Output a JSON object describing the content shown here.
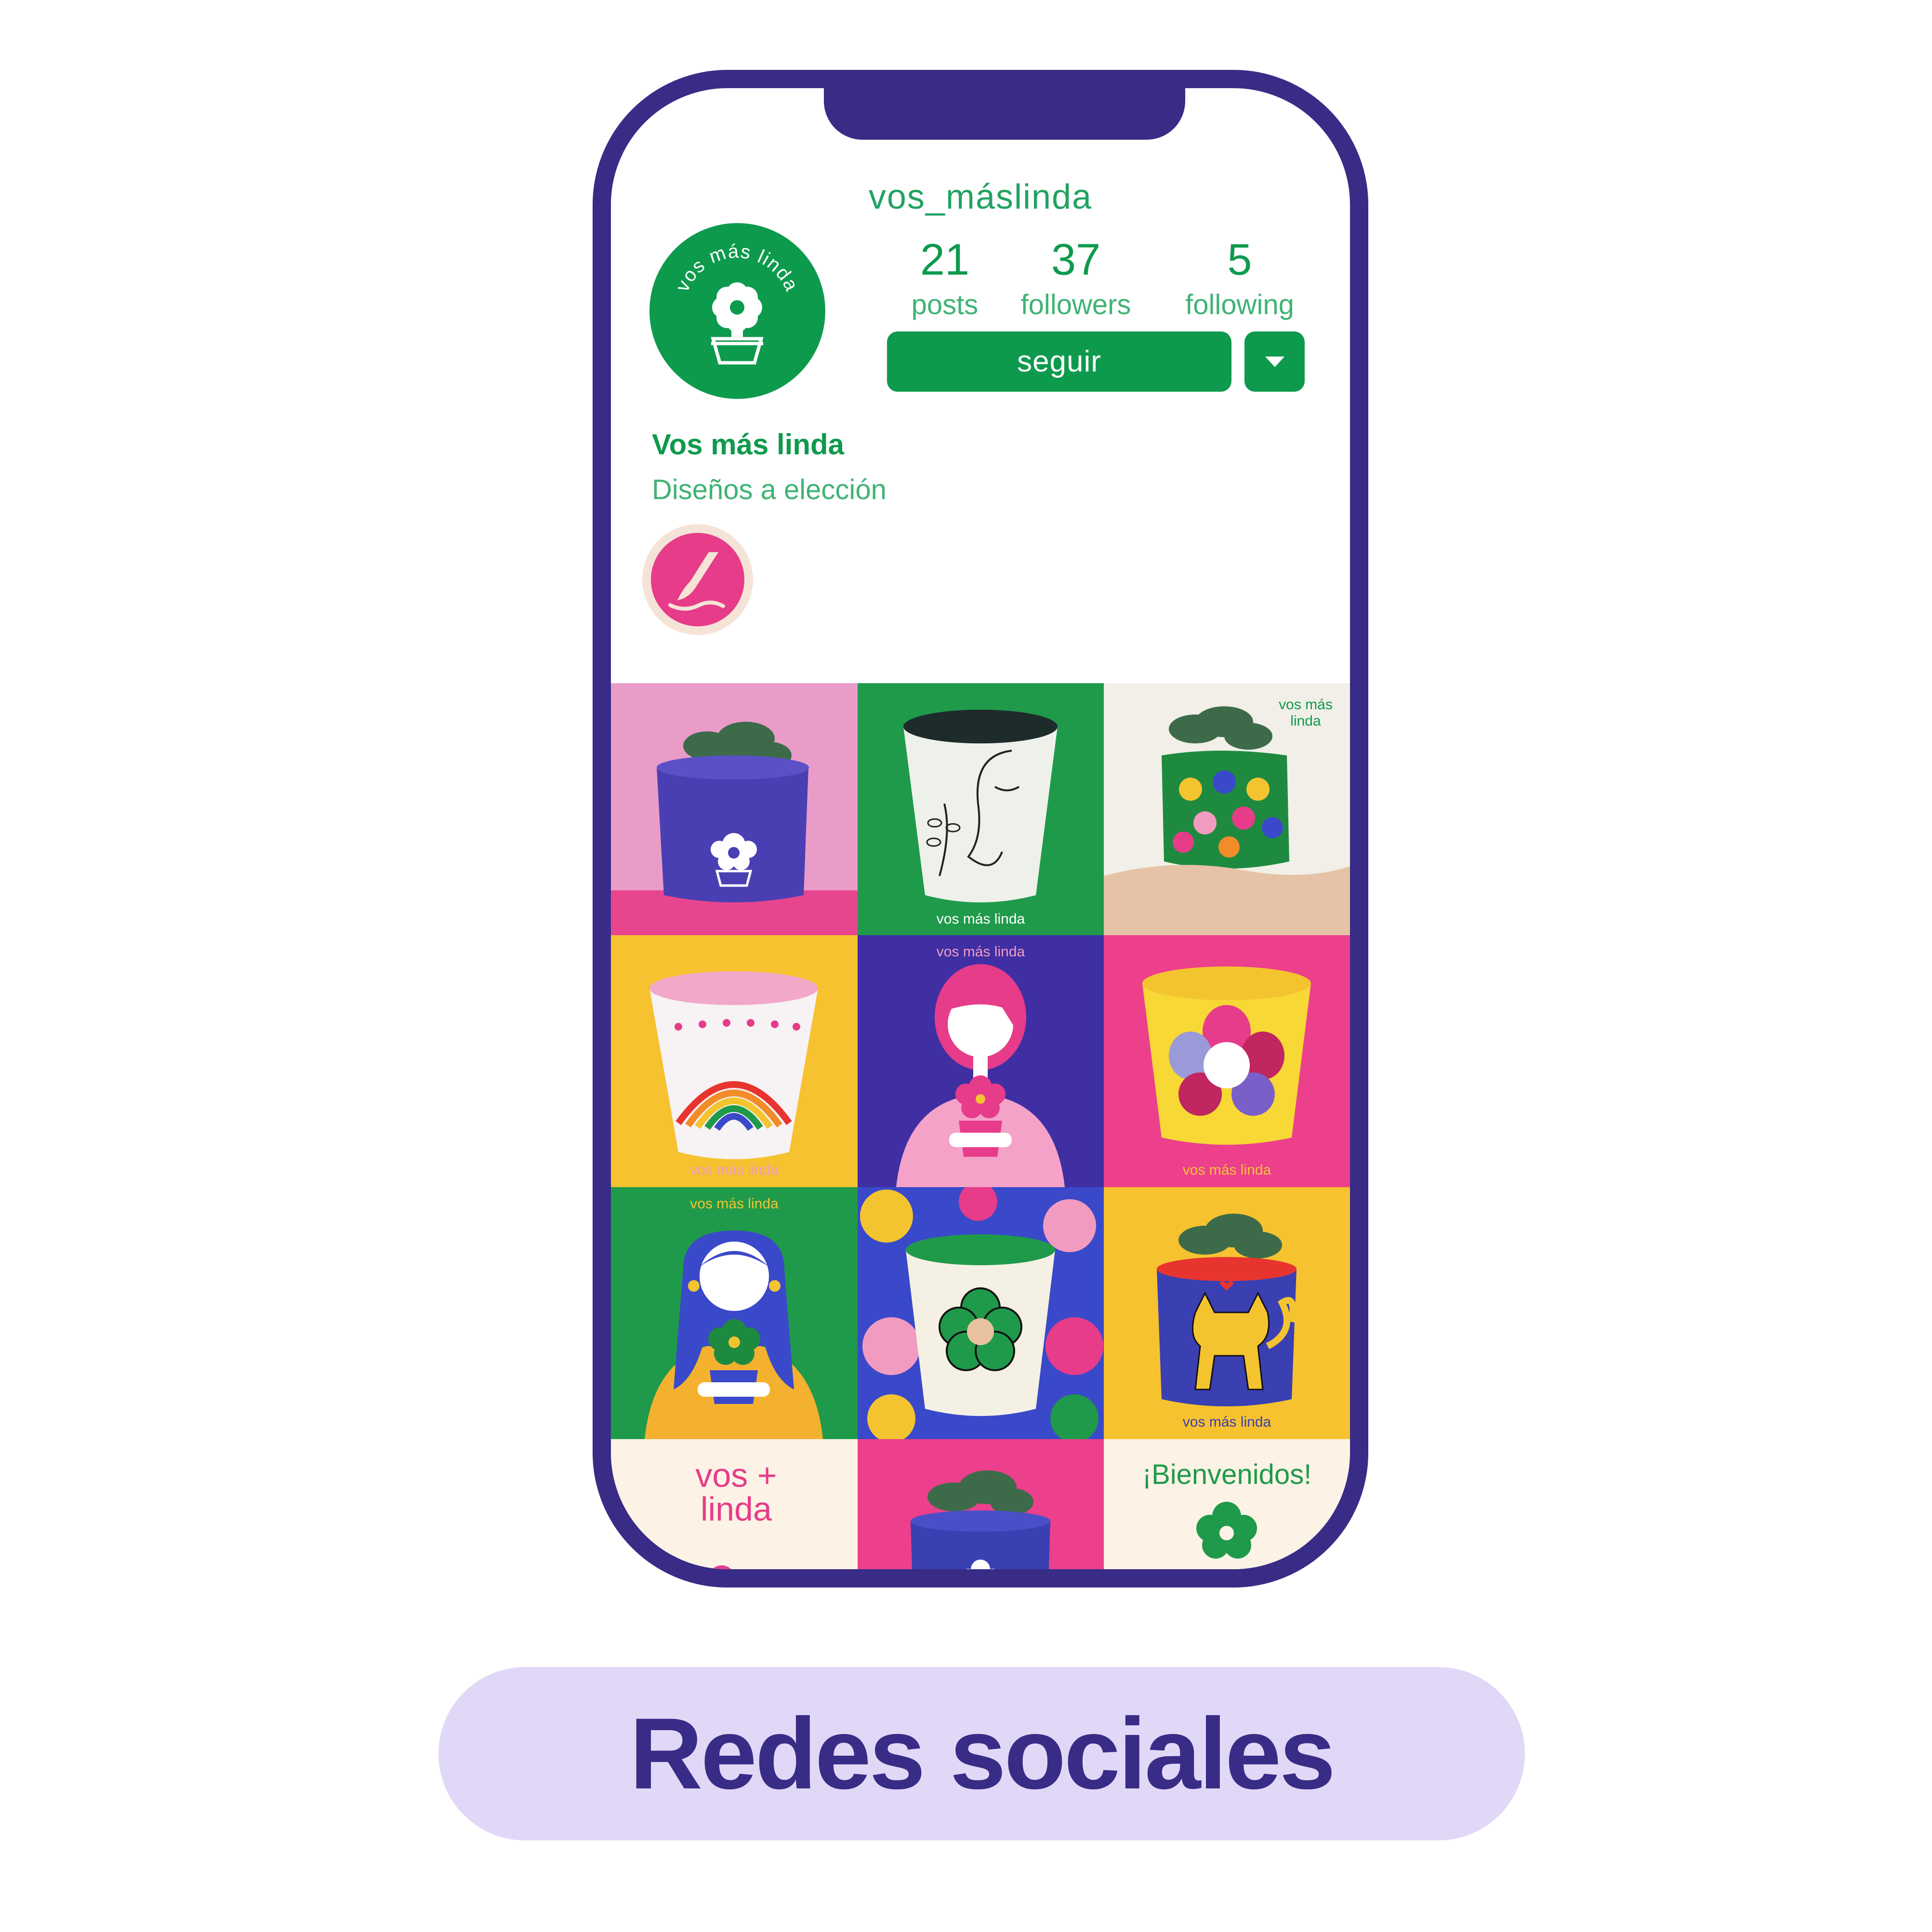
{
  "profile": {
    "username": "vos_máslinda",
    "stats": [
      {
        "value": "21",
        "label": "posts"
      },
      {
        "value": "37",
        "label": "followers"
      },
      {
        "value": "5",
        "label": "following"
      }
    ],
    "follow_label": "seguir",
    "display_name": "Vos más linda",
    "bio": "Diseños a elección",
    "avatar_text": "vos más linda",
    "highlight_icon": "paintbrush-icon"
  },
  "grid": {
    "tiles": [
      {
        "text": ""
      },
      {
        "text": "vos más linda"
      },
      {
        "text": "vos más linda"
      },
      {
        "text": "vos más linda"
      },
      {
        "text": "vos más linda"
      },
      {
        "text": "vos más linda"
      },
      {
        "text": "vos más linda"
      },
      {
        "text": ""
      },
      {
        "text": "vos más linda"
      },
      {
        "text": "vos + linda"
      },
      {
        "text": ""
      },
      {
        "text": "¡Bienvenidos!"
      }
    ]
  },
  "footer": {
    "label": "Redes sociales"
  },
  "colors": {
    "brand_green": "#0e9a4d",
    "phone_frame": "#382c86",
    "pill_bg": "#e1d8f7",
    "pink": "#e63c89"
  }
}
